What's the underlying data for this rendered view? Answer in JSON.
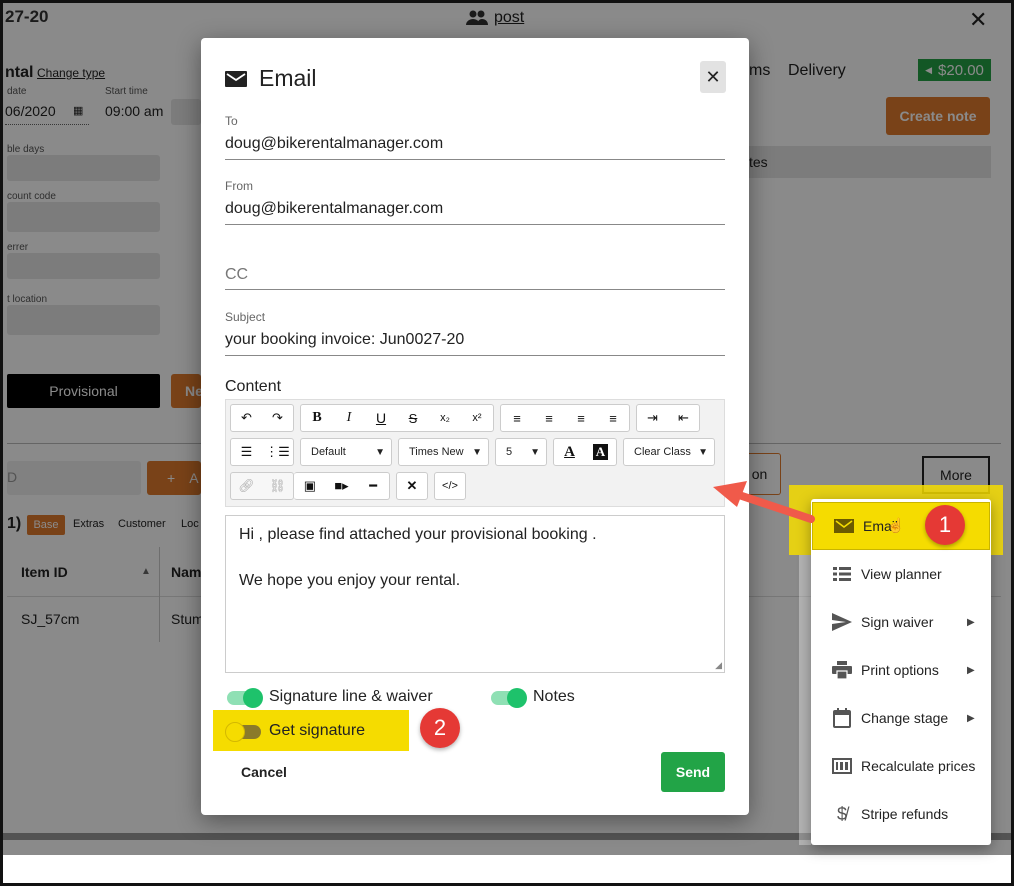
{
  "background": {
    "booking_ref_partial": "27-20",
    "customer_link": "post",
    "rental_label_partial": "ntal",
    "change_type": "Change type",
    "end_date_label_partial": "date",
    "end_date_partial": "06/2020",
    "start_time_label": "Start time",
    "start_time": "09:00 am",
    "billable_days_partial": "ble days",
    "discount_code_partial": "count code",
    "referrer_partial": "errer",
    "location_partial": "t location",
    "provisional_button": "Provisional",
    "ne_button_partial": "Ne",
    "tab_items_partial": "ms",
    "tab_delivery": "Delivery",
    "balance_badge": "$20.00",
    "create_note_button": "Create note",
    "notes_partial": "tes",
    "add_button_partial": "A",
    "add_plus": "+",
    "search_partial": "D",
    "on_button_partial": "on",
    "more_button": "More",
    "count_partial": "1)",
    "sub_tabs": [
      "Base",
      "Extras",
      "Customer",
      "Loc"
    ],
    "table_header_item_id": "Item ID",
    "table_header_name_partial": "Nam",
    "table_row_item_id": "SJ_57cm",
    "table_row_name_partial": "Stum"
  },
  "modal": {
    "title": "Email",
    "to_label": "To",
    "to_value": "doug@bikerentalmanager.com",
    "from_label": "From",
    "from_value": "doug@bikerentalmanager.com",
    "cc_placeholder": "CC",
    "subject_label": "Subject",
    "subject_value": "your booking invoice: Jun0027-20",
    "content_label": "Content",
    "toolbar": {
      "style_select": "Default",
      "font_select": "Times New",
      "size_select": "5",
      "clear_class": "Clear Class"
    },
    "body_line1": "Hi , please find attached your provisional booking .",
    "body_line2": "We hope you enjoy your rental.",
    "toggle_signature_waiver": {
      "label": "Signature line & waiver",
      "on": true
    },
    "toggle_notes": {
      "label": "Notes",
      "on": true
    },
    "toggle_get_signature": {
      "label": "Get signature",
      "on": false
    },
    "cancel_button": "Cancel",
    "send_button": "Send"
  },
  "menu": {
    "items": [
      {
        "label": "Email",
        "icon": "envelope-icon",
        "submenu": false
      },
      {
        "label": "View planner",
        "icon": "list-icon",
        "submenu": false
      },
      {
        "label": "Sign waiver",
        "icon": "send-icon",
        "submenu": true
      },
      {
        "label": "Print options",
        "icon": "printer-icon",
        "submenu": true
      },
      {
        "label": "Change stage",
        "icon": "calendar-icon",
        "submenu": true
      },
      {
        "label": "Recalculate prices",
        "icon": "price-tag-icon",
        "submenu": false
      },
      {
        "label": "Stripe refunds",
        "icon": "money-off-icon",
        "submenu": false
      }
    ]
  },
  "annotations": {
    "step1": "1",
    "step2": "2"
  },
  "colors": {
    "accent_green": "#22a447",
    "toggle_green": "#1ec26b",
    "highlight_yellow": "#f5dc00",
    "orange": "#e07a2e",
    "badge_red": "#e53935"
  }
}
